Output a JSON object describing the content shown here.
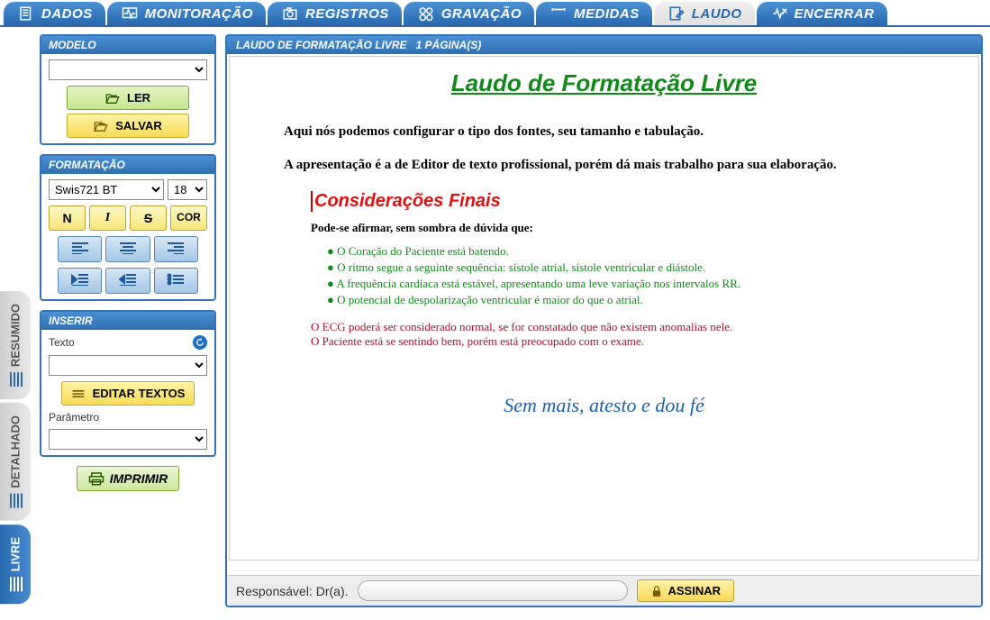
{
  "top_tabs": {
    "dados": "DADOS",
    "monitoracao": "MONITORAÇÃO",
    "registros": "REGISTROS",
    "gravacao": "GRAVAÇÃO",
    "medidas": "MEDIDAS",
    "laudo": "LAUDO",
    "encerrar": "ENCERRAR"
  },
  "side_tabs": {
    "resumido": "RESUMIDO",
    "detalhado": "DETALHADO",
    "livre": "LIVRE"
  },
  "modelo": {
    "header": "MODELO",
    "ler": "LER",
    "salvar": "SALVAR"
  },
  "formatacao": {
    "header": "FORMATAÇÃO",
    "font": "Swis721 BT",
    "size": "18",
    "bold": "N",
    "italic": "I",
    "strike": "S",
    "cor": "COR"
  },
  "inserir": {
    "header": "INSERIR",
    "texto_label": "Texto",
    "editar_textos": "EDITAR TEXTOS",
    "parametro_label": "Parâmetro"
  },
  "imprimir": "IMPRIMIR",
  "doc": {
    "header_title": "LAUDO DE FORMATAÇÃO LIVRE",
    "header_pages": "1  PÁGINA(S)",
    "title": "Laudo de Formatação Livre",
    "p1": "Aqui nós podemos configurar o tipo dos fontes, seu tamanho e tabulação.",
    "p2": "A apresentação é a de Editor de texto profissional, porém dá mais trabalho para sua elaboração.",
    "subtitle": "Considerações Finais",
    "intro": "Pode-se afirmar, sem sombra de dúvida que:",
    "bullets": [
      "O Coração do Paciente está batendo.",
      "O ritmo segue a seguinte sequência: sístole atrial, sístole ventricular e diástole.",
      "A frequência cardíaca está estável, apresentando uma leve variação nos intervalos RR.",
      "O potencial de despolarização ventricular é maior do que o atrial."
    ],
    "note1": "O ECG poderá ser considerado normal, se for constatado que não existem anomalias nele.",
    "note2": "O Paciente está se sentindo bem, porém está preocupado com o exame.",
    "signoff": "Sem mais, atesto e dou fé"
  },
  "footer": {
    "responsavel": "Responsável: Dr(a).",
    "assinar": "ASSINAR"
  }
}
